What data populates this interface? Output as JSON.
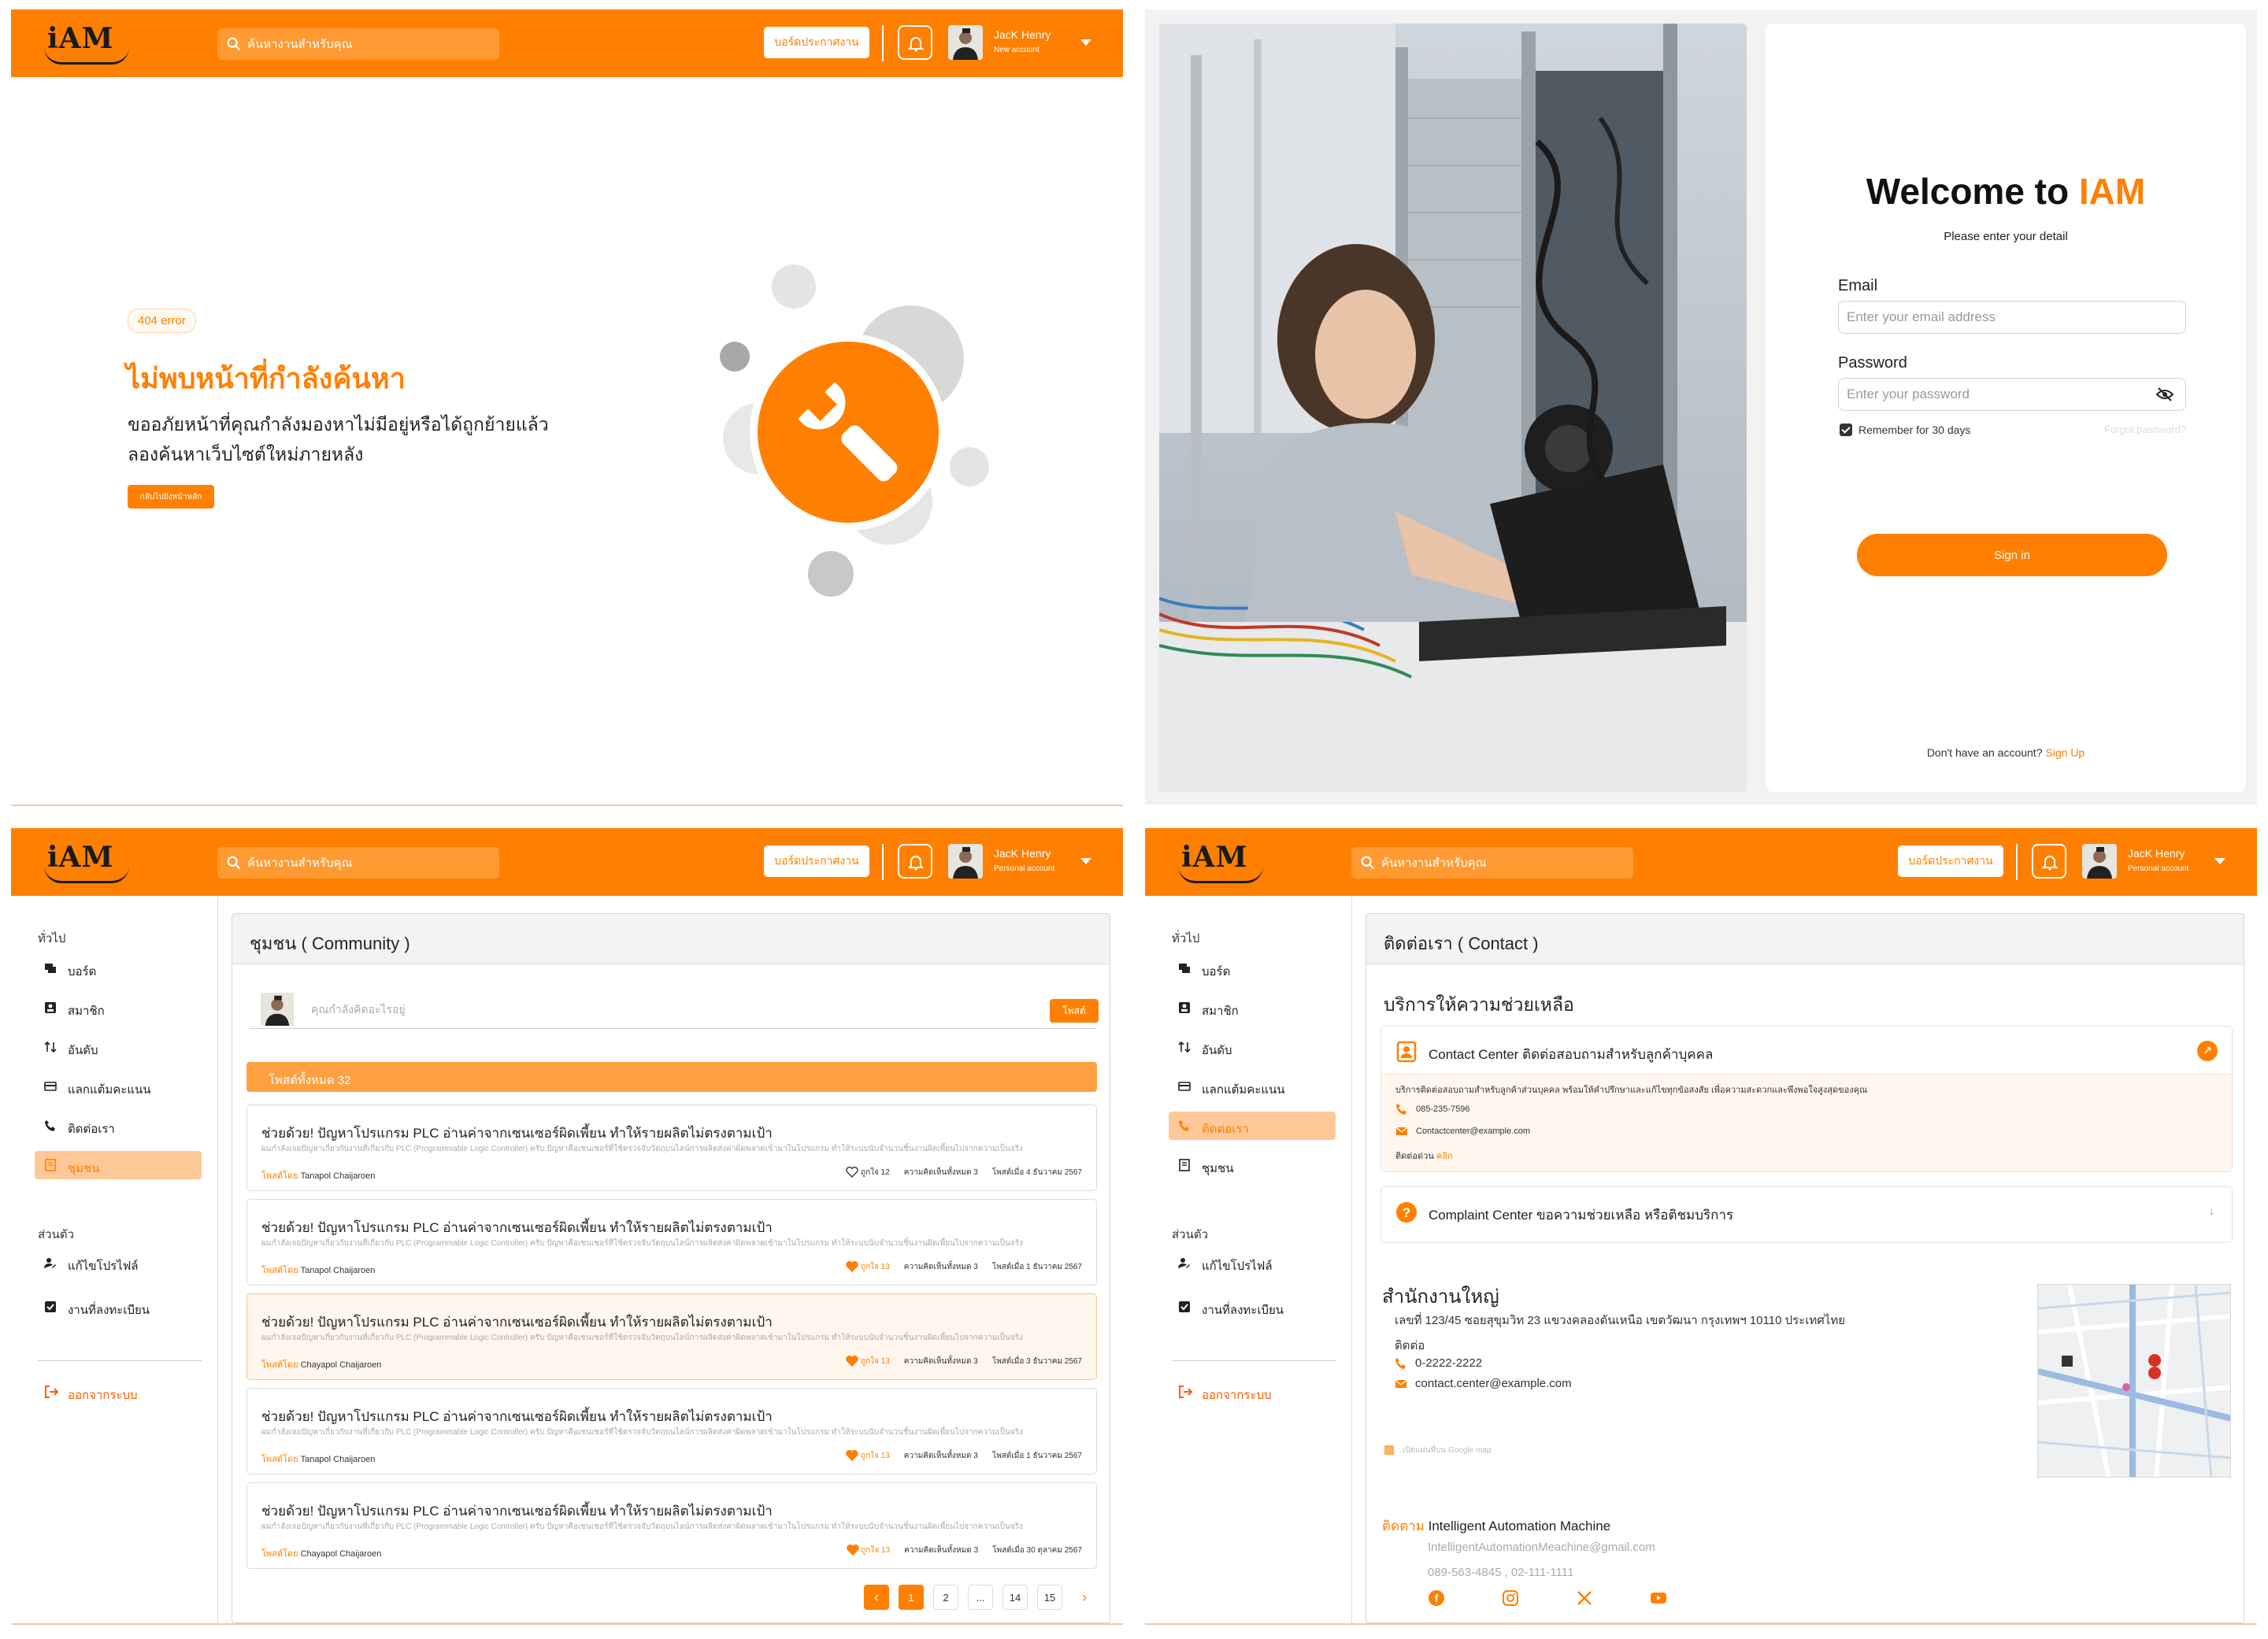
{
  "header": {
    "logo": "iAM",
    "search_placeholder": "ค้นหางานสำหรับคุณ",
    "board_button": "บอร์ดประกาศงาน",
    "user_name": "JacK Henry",
    "user_sub_new": "New account",
    "user_sub_personal": "Personal account"
  },
  "error404": {
    "badge": "404 error",
    "title": "ไม่พบหน้าที่กำลังค้นหา",
    "desc_line1": "ขออภัยหน้าที่คุณกำลังมองหาไม่มีอยู่หรือได้ถูกย้ายแล้ว",
    "desc_line2": "ลองค้นหาเว็บไซต์ใหม่ภายหลัง",
    "back_button": "กลับไปยังหน้าหลัก",
    "icon": "wrench-icon"
  },
  "login": {
    "welcome": "Welcome to ",
    "brand": "IAM",
    "subtitle": "Please enter your detail",
    "email_label": "Email",
    "email_placeholder": "Enter your email address",
    "password_label": "Password",
    "password_placeholder": "Enter your password",
    "remember": "Remember for 30 days",
    "remember_checked": true,
    "forgot": "Forgot password?",
    "signin": "Sign in",
    "no_account": "Don't have an account? ",
    "signup": "Sign Up"
  },
  "sidebar": {
    "section_general": "ทั่วไป",
    "items": [
      "บอร์ด",
      "สมาชิก",
      "อันดับ",
      "แลกแต้มคะแนน",
      "ติดต่อเรา",
      "ชุมชน"
    ],
    "section_personal": "ส่วนตัว",
    "personal_items": [
      "แก้ไขโปรไฟล์",
      "งานที่ลงทะเบียน"
    ],
    "logout": "ออกจากระบบ"
  },
  "community": {
    "title": "ชุมชน ( Community )",
    "post_placeholder": "คุณกำลังคิดอะไรอยู่",
    "post_button": "โพสต์",
    "count_label": "โพสต์ทั้งหมด  32",
    "posts": [
      {
        "title": "ช่วยด้วย! ปัญหาโปรแกรม PLC อ่านค่าจากเซนเซอร์ผิดเพี้ยน ทำให้รายผลิตไม่ตรงตามเป้า",
        "preview": "ผมกำลังเจอปัญหาเกี่ยวกับงานที่เกี่ยวกับ PLC (Programmable Logic Controller) ครับ ปัญหาคือเซนเซอร์ที่ใช้ตรวจจับวัตถุบนไลน์การผลิตส่งค่าผิดพลาดเข้ามาในโปรแกรม ทำให้ระบบนับจำนวนชิ้นงานผิดเพี้ยนไปจากความเป็นจริง",
        "by_label": "โพสต์โดย ",
        "author": "Tanapol Chaijaroen",
        "likes": "ถูกใจ  12",
        "comments": "ความคิดเห็นทั้งหมด  3",
        "date": "โพสต์เมื่อ  4 ธันวาคม 2567",
        "liked": false
      },
      {
        "title": "ช่วยด้วย! ปัญหาโปรแกรม PLC อ่านค่าจากเซนเซอร์ผิดเพี้ยน ทำให้รายผลิตไม่ตรงตามเป้า",
        "preview": "ผมกำลังเจอปัญหาเกี่ยวกับงานที่เกี่ยวกับ PLC (Programmable Logic Controller) ครับ ปัญหาคือเซนเซอร์ที่ใช้ตรวจจับวัตถุบนไลน์การผลิตส่งค่าผิดพลาดเข้ามาในโปรแกรม ทำให้ระบบนับจำนวนชิ้นงานผิดเพี้ยนไปจากความเป็นจริง",
        "by_label": "โพสต์โดย ",
        "author": "Tanapol Chaijaroen",
        "likes": "ถูกใจ  13",
        "comments": "ความคิดเห็นทั้งหมด  3",
        "date": "โพสต์เมื่อ  1 ธันวาคม 2567",
        "liked": true
      },
      {
        "title": "ช่วยด้วย! ปัญหาโปรแกรม PLC อ่านค่าจากเซนเซอร์ผิดเพี้ยน ทำให้รายผลิตไม่ตรงตามเป้า",
        "preview": "ผมกำลังเจอปัญหาเกี่ยวกับงานที่เกี่ยวกับ PLC (Programmable Logic Controller) ครับ ปัญหาคือเซนเซอร์ที่ใช้ตรวจจับวัตถุบนไลน์การผลิตส่งค่าผิดพลาดเข้ามาในโปรแกรม ทำให้ระบบนับจำนวนชิ้นงานผิดเพี้ยนไปจากความเป็นจริง",
        "by_label": "โพสต์โดย ",
        "author": "Chayapol Chaijaroen",
        "likes": "ถูกใจ  13",
        "comments": "ความคิดเห็นทั้งหมด  3",
        "date": "โพสต์เมื่อ  3 ธันวาคม 2567",
        "liked": true
      },
      {
        "title": "ช่วยด้วย! ปัญหาโปรแกรม PLC อ่านค่าจากเซนเซอร์ผิดเพี้ยน ทำให้รายผลิตไม่ตรงตามเป้า",
        "preview": "ผมกำลังเจอปัญหาเกี่ยวกับงานที่เกี่ยวกับ PLC (Programmable Logic Controller) ครับ ปัญหาคือเซนเซอร์ที่ใช้ตรวจจับวัตถุบนไลน์การผลิตส่งค่าผิดพลาดเข้ามาในโปรแกรม ทำให้ระบบนับจำนวนชิ้นงานผิดเพี้ยนไปจากความเป็นจริง",
        "by_label": "โพสต์โดย ",
        "author": "Tanapol Chaijaroen",
        "likes": "ถูกใจ  13",
        "comments": "ความคิดเห็นทั้งหมด  3",
        "date": "โพสต์เมื่อ  1 ธันวาคม 2567",
        "liked": true
      },
      {
        "title": "ช่วยด้วย! ปัญหาโปรแกรม PLC อ่านค่าจากเซนเซอร์ผิดเพี้ยน ทำให้รายผลิตไม่ตรงตามเป้า",
        "preview": "ผมกำลังเจอปัญหาเกี่ยวกับงานที่เกี่ยวกับ PLC (Programmable Logic Controller) ครับ ปัญหาคือเซนเซอร์ที่ใช้ตรวจจับวัตถุบนไลน์การผลิตส่งค่าผิดพลาดเข้ามาในโปรแกรม ทำให้ระบบนับจำนวนชิ้นงานผิดเพี้ยนไปจากความเป็นจริง",
        "by_label": "โพสต์โดย ",
        "author": "Chayapol Chaijaroen",
        "likes": "ถูกใจ  13",
        "comments": "ความคิดเห็นทั้งหมด  3",
        "date": "โพสต์เมื่อ  30 ตุลาคม 2567",
        "liked": true
      }
    ],
    "pages": [
      "1",
      "2",
      "...",
      "14",
      "15"
    ],
    "current_page": "1"
  },
  "contact": {
    "title": "ติดต่อเรา ( Contact )",
    "section": "บริการให้ความช่วยเหลือ",
    "center_title": "Contact Center ติดต่อสอบถามสำหรับลูกค้าบุคคล",
    "center_desc": "บริการติดต่อสอบถามสำหรับลูกค้าส่วนบุคคล พร้อมให้คำปรึกษาและแก้ไขทุกข้อสงสัย เพื่อความสะดวกและพึงพอใจสูงสุดของคุณ",
    "center_phone": "085-235-7596",
    "center_email": "Contactcenter@example.com",
    "center_urgent_label": "ติดต่อด่วน ",
    "center_urgent_link": "คลิก",
    "complaint_title": "Complaint Center ขอความช่วยเหลือ หรือติชมบริการ",
    "hq_title": "สำนักงานใหญ่",
    "hq_address": "เลขที่ 123/45 ซอยสุขุมวิท 23 แขวงคลองตันเหนือ เขตวัฒนา กรุงเทพฯ 10110 ประเทศไทย",
    "hq_contact_label": "ติดต่อ",
    "hq_phone": "0-2222-2222",
    "hq_email": "contact.center@example.com",
    "gmap_label": "เปิดแผนที่บน Google map",
    "follow_label": "ติดตาม ",
    "follow_name": "Intelligent Automation Machine",
    "follow_email": "IntelligentAutomationMeachine@gmail.com",
    "follow_tel": "089-563-4845 , 02-111-1111",
    "socials": [
      "facebook-icon",
      "instagram-icon",
      "x-icon",
      "youtube-icon"
    ]
  },
  "colors": {
    "accent": "#ff8000",
    "accent_light": "#ffc898",
    "bar": "#ffa040"
  }
}
